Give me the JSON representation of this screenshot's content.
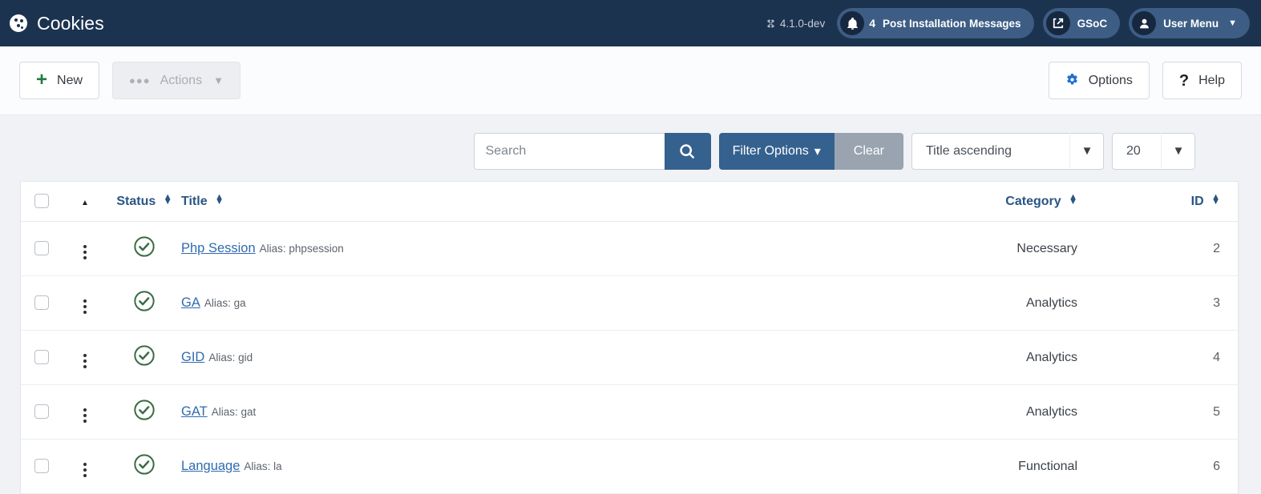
{
  "header": {
    "logo_icon": "cookie-icon",
    "title": "Cookies",
    "version_icon": "joomla-logo-icon",
    "version": "4.1.0-dev",
    "messages": {
      "icon": "bell-icon",
      "count": "4",
      "label": "Post Installation Messages"
    },
    "gsoc": {
      "icon": "external-link-icon",
      "label": "GSoC"
    },
    "user_menu": {
      "icon": "user-avatar-icon",
      "label": "User Menu",
      "caret": "chevron-down-icon"
    }
  },
  "toolbar": {
    "new_label": "New",
    "new_icon": "plus-icon",
    "actions_label": "Actions",
    "actions_icon": "ellipsis-icon",
    "actions_caret": "chevron-down-icon",
    "actions_disabled": true,
    "options_label": "Options",
    "options_icon": "gear-icon",
    "help_label": "Help",
    "help_icon": "question-mark-icon"
  },
  "filters": {
    "search_placeholder": "Search",
    "search_value": "",
    "search_button_icon": "magnifier-icon",
    "filter_options_label": "Filter Options",
    "filter_options_caret": "chevron-down-icon",
    "clear_label": "Clear",
    "ordering_value": "Title ascending",
    "ordering_caret": "chevron-down-icon",
    "limit_value": "20",
    "limit_caret": "chevron-down-icon"
  },
  "table": {
    "columns": {
      "check": "",
      "ordering_icon": "sort-asc-arrow-icon",
      "status": "Status",
      "title": "Title",
      "category": "Category",
      "id": "ID"
    },
    "alias_prefix": "Alias:",
    "rows": [
      {
        "status_icon": "check-circle-icon",
        "title": "Php Session",
        "alias": "Alias: phpsession",
        "category": "Necessary",
        "id": "2"
      },
      {
        "status_icon": "check-circle-icon",
        "title": "GA",
        "alias": "Alias: ga",
        "category": "Analytics",
        "id": "3"
      },
      {
        "status_icon": "check-circle-icon",
        "title": "GID",
        "alias": "Alias: gid",
        "category": "Analytics",
        "id": "4"
      },
      {
        "status_icon": "check-circle-icon",
        "title": "GAT",
        "alias": "Alias: gat",
        "category": "Analytics",
        "id": "5"
      },
      {
        "status_icon": "check-circle-icon",
        "title": "Language",
        "alias": "Alias: la",
        "category": "Functional",
        "id": "6"
      }
    ]
  },
  "colors": {
    "header_bg": "#1c3350",
    "accent_blue": "#35618f",
    "link_blue": "#2f6bb0",
    "status_green": "#3a6b42",
    "new_green": "#257a41",
    "clear_grey": "#9aa4b0",
    "page_bg": "#f0f2f5"
  }
}
